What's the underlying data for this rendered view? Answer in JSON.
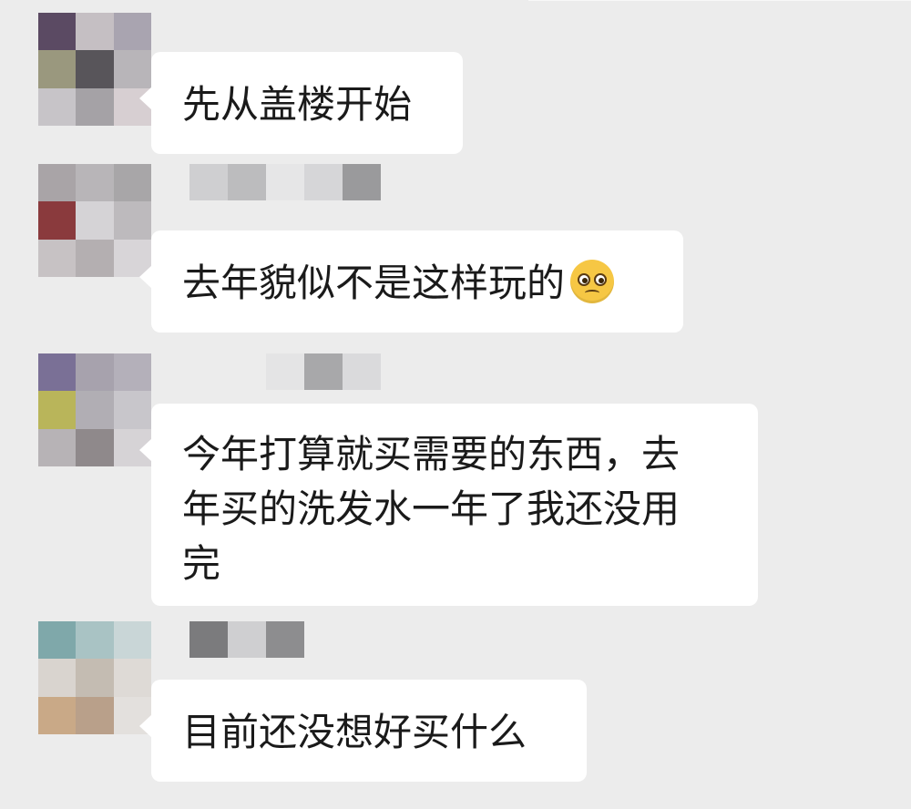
{
  "messages": [
    {
      "avatar_colors": [
        "#5b4a63",
        "#c5bfc3",
        "#a9a4b0",
        "#9a987e",
        "#58555a",
        "#b8b5b9",
        "#c7c4c8",
        "#a5a2a6",
        "#d7cfd2"
      ],
      "nick_colors": [],
      "lines": [
        "先从盖楼开始"
      ],
      "emoji": null
    },
    {
      "avatar_colors": [
        "#a9a4a7",
        "#b8b5b8",
        "#a8a6a8",
        "#8a3a3d",
        "#d5d3d6",
        "#bdbabd",
        "#c7c2c4",
        "#b4afb1",
        "#d8d5d8"
      ],
      "nick_colors": [
        "#cfcfd1",
        "#bcbcbe",
        "#e6e6e7",
        "#d6d6d8",
        "#9a9a9c"
      ],
      "lines": [
        "去年貌似不是这样玩的"
      ],
      "emoji": "pleading-face"
    },
    {
      "avatar_colors": [
        "#7a7096",
        "#a7a2ad",
        "#b4b0ba",
        "#b9b55a",
        "#b1aeb4",
        "#c8c6cb",
        "#b7b3b6",
        "#8f898b",
        "#d6d3d6"
      ],
      "nick_colors": [
        "#e4e4e5",
        "#a8a8aa",
        "#dadadc"
      ],
      "lines": [
        "今年打算就买需要的东西，去",
        "年买的洗发水一年了我还没用",
        "完"
      ],
      "emoji": null
    },
    {
      "avatar_colors": [
        "#7fa8aa",
        "#a9c3c4",
        "#c9d6d7",
        "#d9d4cf",
        "#c4bcb2",
        "#dedad6",
        "#c9a987",
        "#b9a08a",
        "#e3e0dd"
      ],
      "nick_colors": [
        "#7b7b7d",
        "#cfcfd1",
        "#8d8d8f"
      ],
      "lines": [
        "目前还没想好买什么"
      ],
      "emoji": null
    }
  ]
}
